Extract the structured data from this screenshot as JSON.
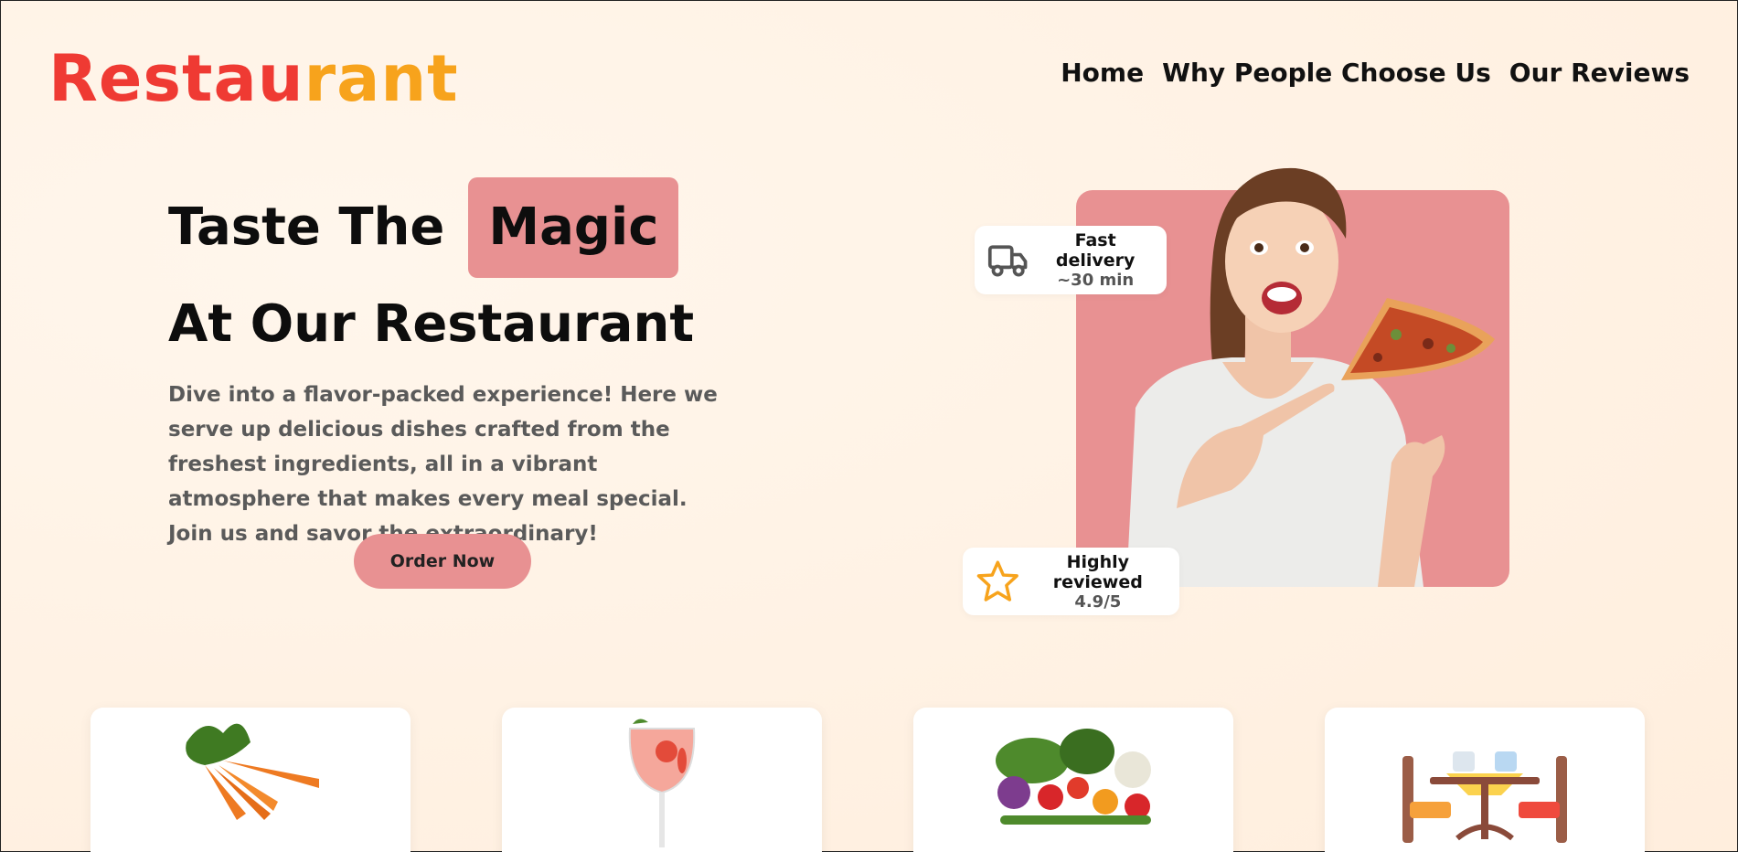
{
  "logo": {
    "part1": "Restau",
    "part2": "rant"
  },
  "nav": {
    "items": [
      "Home",
      "Why People Choose Us",
      "Our Reviews"
    ]
  },
  "hero": {
    "title_line1": "Taste The",
    "title_highlight": "Magic",
    "title_line2": "At Our Restaurant",
    "description": "Dive into a flavor-packed experience! Here we serve up delicious dishes crafted from the freshest ingredients, all in a vibrant atmosphere that makes every meal special. Join us and savor the extraordinary!",
    "cta_label": "Order Now"
  },
  "badges": {
    "delivery": {
      "title": "Fast delivery",
      "value": "~30 min",
      "icon": "truck-icon"
    },
    "review": {
      "title": "Highly reviewed",
      "value": "4.9/5",
      "icon": "star-icon"
    }
  },
  "cards": [
    {
      "image": "carrots"
    },
    {
      "image": "drink-glass"
    },
    {
      "image": "vegetables"
    },
    {
      "image": "table-chairs"
    }
  ],
  "colors": {
    "accent": "#e89192",
    "brand_red": "#ef3a33",
    "brand_orange": "#f7a31c"
  }
}
